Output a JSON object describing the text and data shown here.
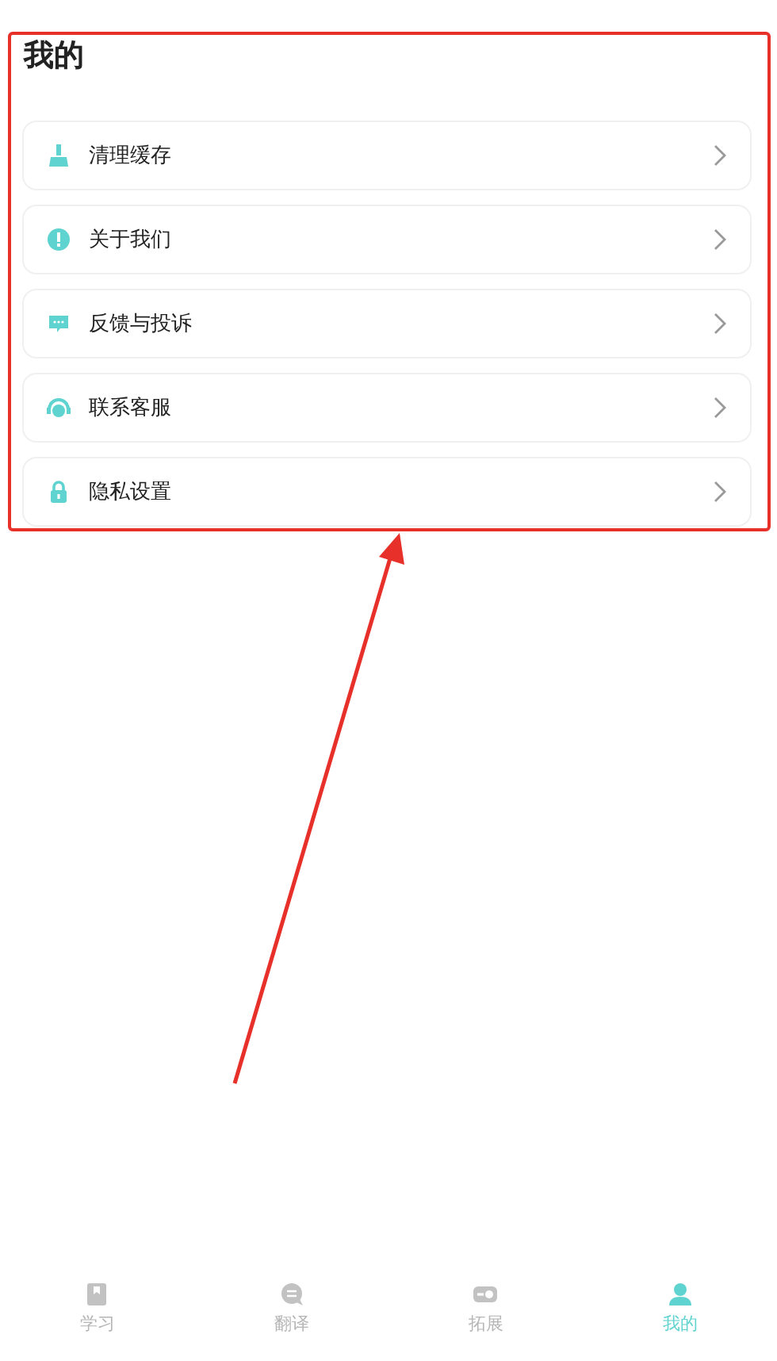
{
  "page": {
    "title": "我的"
  },
  "menu": [
    {
      "kind": "broom",
      "label": "清理缓存"
    },
    {
      "kind": "info",
      "label": "关于我们"
    },
    {
      "kind": "chat",
      "label": "反馈与投诉"
    },
    {
      "kind": "headset",
      "label": "联系客服"
    },
    {
      "kind": "lock",
      "label": "隐私设置"
    }
  ],
  "tab_bar": [
    {
      "kind": "book",
      "label": "学习",
      "selected": false
    },
    {
      "kind": "translate",
      "label": "翻译",
      "selected": false
    },
    {
      "kind": "toggle",
      "label": "拓展",
      "selected": false
    },
    {
      "kind": "person",
      "label": "我的",
      "selected": true
    }
  ]
}
